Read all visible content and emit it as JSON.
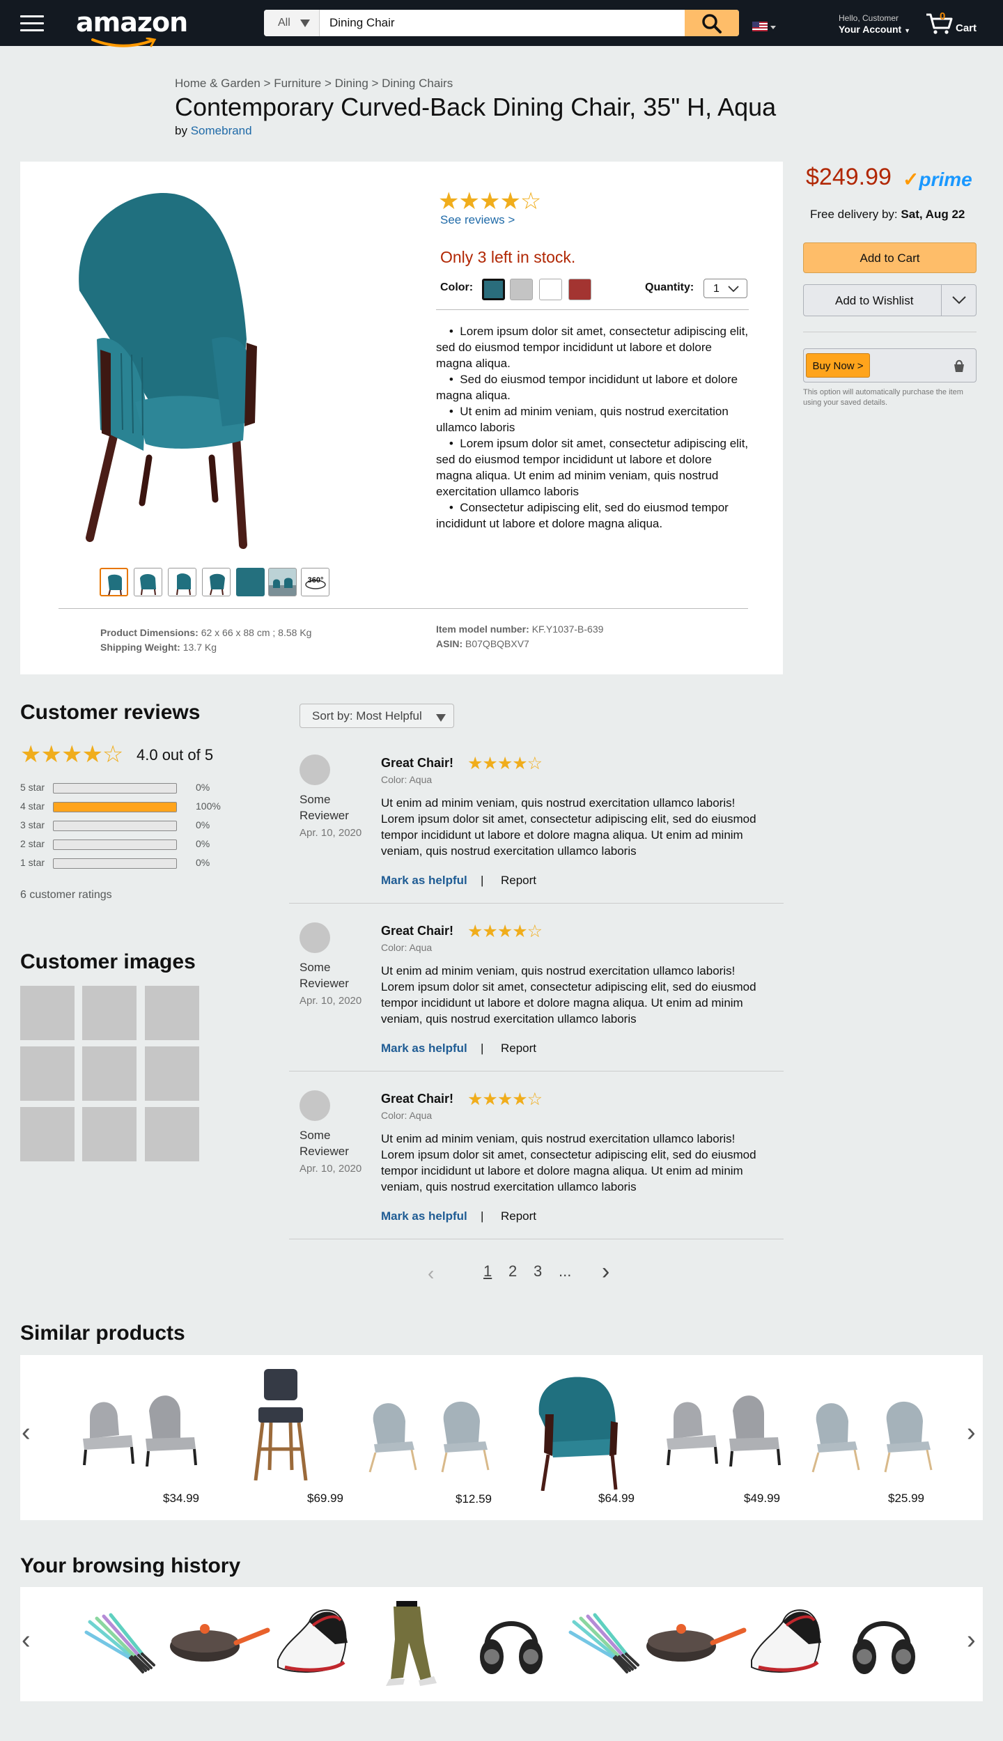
{
  "header": {
    "logo": "amazon",
    "search_category": "All",
    "search_query": "Dining Chair",
    "account_greeting": "Hello, Customer",
    "account_label": "Your Account",
    "cart_count": "0",
    "cart_label": "Cart"
  },
  "breadcrumb": "Home & Garden > Furniture > Dining > Dining Chairs",
  "product": {
    "title": "Contemporary Curved-Back Dining Chair, 35\" H, Aqua",
    "by_prefix": "by",
    "brand": "Somebrand",
    "rating_stars": 4,
    "see_reviews": "See reviews >",
    "stock": "Only 3 left in stock.",
    "color_label": "Color:",
    "colors": [
      "#2a6d7c",
      "#c4c4c4",
      "#ffffff",
      "#a33431"
    ],
    "quantity_label": "Quantity:",
    "quantity_value": "1",
    "bullets": [
      "Lorem ipsum dolor sit amet, consectetur adipiscing elit, sed do eiusmod tempor incididunt ut labore et dolore magna aliqua.",
      "Sed do eiusmod tempor incididunt ut labore et dolore magna aliqua.",
      "Ut enim ad minim veniam, quis nostrud exercitation ullamco laboris",
      "Lorem ipsum dolor sit amet, consectetur adipiscing elit, sed do eiusmod tempor incididunt ut labore et dolore magna aliqua. Ut enim ad minim veniam, quis nostrud exercitation ullamco laboris",
      "Consectetur adipiscing elit, sed do eiusmod tempor incididunt ut labore et dolore magna aliqua."
    ],
    "thumb_360_label": "360°",
    "details": {
      "dimensions_label": "Product Dimensions:",
      "dimensions_value": "62 x 66 x 88 cm ; 8.58 Kg",
      "weight_label": "Shipping Weight:",
      "weight_value": "13.7 Kg",
      "model_label": "Item model number:",
      "model_value": "KF.Y1037-B-639",
      "asin_label": "ASIN:",
      "asin_value": "B07QBQBXV7"
    }
  },
  "buybox": {
    "price": "$249.99",
    "prime": "prime",
    "delivery_prefix": "Free delivery by:",
    "delivery_date": "Sat, Aug 22",
    "add_to_cart": "Add to Cart",
    "add_to_wishlist": "Add to Wishlist",
    "buy_now": "Buy Now >",
    "buy_now_note": "This option will automatically purchase the item using your saved details."
  },
  "reviews_summary": {
    "title": "Customer reviews",
    "rating_text": "4.0 out of 5",
    "rating_stars": 4,
    "bars": [
      {
        "label": "5 star",
        "pct_text": "0%",
        "fraction": 0
      },
      {
        "label": "4 star",
        "pct_text": "100%",
        "fraction": 1
      },
      {
        "label": "3 star",
        "pct_text": "0%",
        "fraction": 0
      },
      {
        "label": "2 star",
        "pct_text": "0%",
        "fraction": 0
      },
      {
        "label": "1 star",
        "pct_text": "0%",
        "fraction": 0
      }
    ],
    "ratings_count": "6 customer ratings",
    "images_title": "Customer images"
  },
  "reviews": {
    "sort_label": "Sort by: Most Helpful",
    "items": [
      {
        "name": "Some Reviewer",
        "date": "Apr. 10, 2020",
        "title": "Great Chair!",
        "stars": 4,
        "color": "Color: Aqua",
        "body": "Ut enim ad minim veniam, quis nostrud exercitation ullamco laboris! Lorem ipsum dolor sit amet, consectetur adipiscing elit, sed do eiusmod tempor incididunt ut labore et dolore magna aliqua. Ut enim ad minim veniam, quis nostrud exercitation ullamco laboris",
        "helpful": "Mark as helpful",
        "separator": "|",
        "report": "Report"
      },
      {
        "name": "Some Reviewer",
        "date": "Apr. 10, 2020",
        "title": "Great Chair!",
        "stars": 4,
        "color": "Color: Aqua",
        "body": "Ut enim ad minim veniam, quis nostrud exercitation ullamco laboris! Lorem ipsum dolor sit amet, consectetur adipiscing elit, sed do eiusmod tempor incididunt ut labore et dolore magna aliqua. Ut enim ad minim veniam, quis nostrud exercitation ullamco laboris",
        "helpful": "Mark as helpful",
        "separator": "|",
        "report": "Report"
      },
      {
        "name": "Some Reviewer",
        "date": "Apr. 10, 2020",
        "title": "Great Chair!",
        "stars": 4,
        "color": "Color: Aqua",
        "body": "Ut enim ad minim veniam, quis nostrud exercitation ullamco laboris! Lorem ipsum dolor sit amet, consectetur adipiscing elit, sed do eiusmod tempor incididunt ut labore et dolore magna aliqua. Ut enim ad minim veniam, quis nostrud exercitation ullamco laboris",
        "helpful": "Mark as helpful",
        "separator": "|",
        "report": "Report"
      }
    ],
    "pagination": {
      "pages": [
        "1",
        "2",
        "3",
        "..."
      ],
      "current": "1"
    }
  },
  "similar": {
    "title": "Similar products",
    "prices": [
      "$34.99",
      "$69.99",
      "$12.59",
      "$64.99",
      "$49.99",
      "$25.99"
    ]
  },
  "history": {
    "title": "Your browsing history"
  },
  "colors": {
    "header_bg": "#131921",
    "accent_orange": "#febd69",
    "price_red": "#b12704",
    "link_blue": "#1f6aa8",
    "star_gold": "#f0ad1c"
  }
}
